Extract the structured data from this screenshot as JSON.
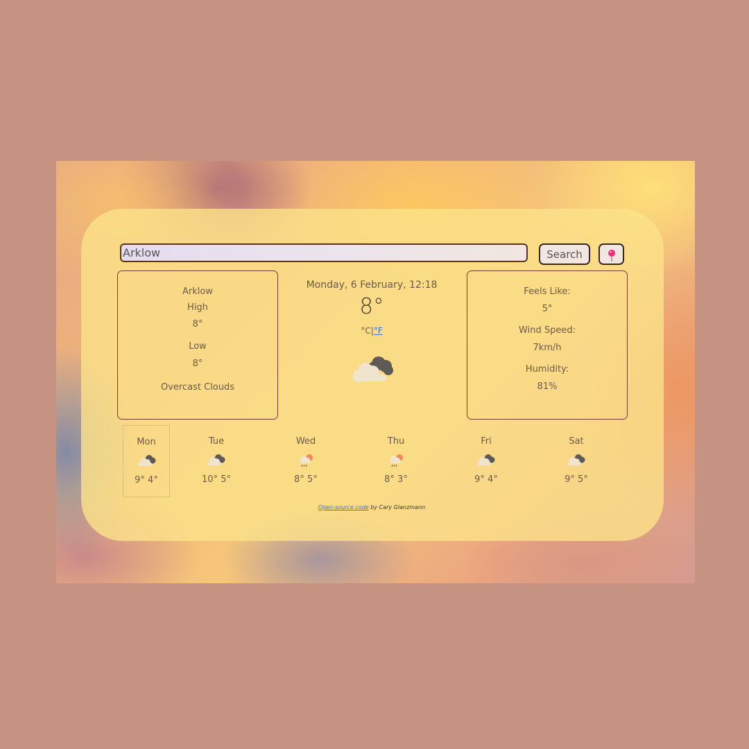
{
  "search": {
    "value": "Arklow",
    "button_label": "Search",
    "location_icon": "map-pin-icon"
  },
  "left_panel": {
    "city": "Arklow",
    "high_label": "High",
    "high_value": "8°",
    "low_label": "Low",
    "low_value": "8°",
    "description": "Overcast Clouds"
  },
  "current": {
    "datetime": "Monday, 6 February, 12:18",
    "temperature": "8°",
    "unit_celsius": "°C",
    "unit_separator": "|",
    "unit_fahrenheit": "°F",
    "icon": "overcast-clouds-icon"
  },
  "right_panel": {
    "feels_like_label": "Feels Like:",
    "feels_like_value": "5°",
    "wind_label": "Wind Speed:",
    "wind_value": "7km/h",
    "humidity_label": "Humidity:",
    "humidity_value": "81%"
  },
  "forecast": [
    {
      "day": "Mon",
      "temps": "9° 4°",
      "icon": "overcast-clouds-icon"
    },
    {
      "day": "Tue",
      "temps": "10° 5°",
      "icon": "overcast-clouds-icon"
    },
    {
      "day": "Wed",
      "temps": "8° 5°",
      "icon": "rain-sun-icon"
    },
    {
      "day": "Thu",
      "temps": "8° 3°",
      "icon": "rain-sun-icon"
    },
    {
      "day": "Fri",
      "temps": "9° 4°",
      "icon": "overcast-clouds-icon"
    },
    {
      "day": "Sat",
      "temps": "9° 5°",
      "icon": "overcast-clouds-icon"
    }
  ],
  "footer": {
    "link_text": "Open-source code",
    "suffix": " by Cary Glanzmann"
  },
  "colors": {
    "page_background": "#c69282",
    "card": "#fbe28a",
    "panel_border": "#7a3a30",
    "link": "#3a6fd0",
    "pin": "#e8307a"
  }
}
